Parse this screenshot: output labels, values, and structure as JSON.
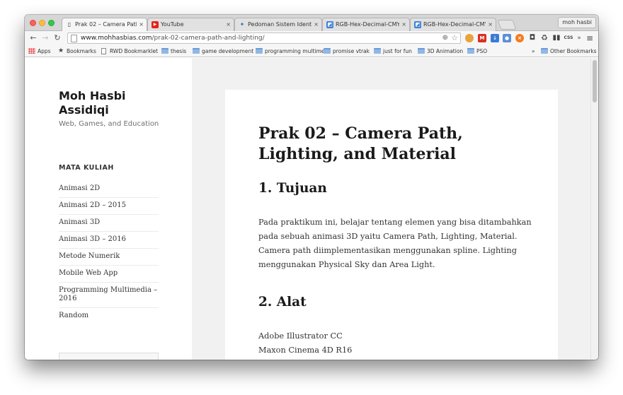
{
  "browser": {
    "tabs": [
      {
        "title": "Prak 02 – Camera Path, Lig",
        "icon": "page-icon",
        "active": true
      },
      {
        "title": "YouTube",
        "icon": "youtube-icon",
        "active": false
      },
      {
        "title": "Pedoman Sistem Identitas",
        "icon": "logo-icon",
        "active": false
      },
      {
        "title": "RGB-Hex-Decimal-CMYK C",
        "icon": "color-icon",
        "active": false
      },
      {
        "title": "RGB-Hex-Decimal-CMYK C",
        "icon": "color-icon",
        "active": false
      }
    ],
    "tab_close_glyph": "×",
    "profile_name": "moh hasbi",
    "url_domain": "www.mohhasbias.com",
    "url_path": "/prak-02-camera-path-and-lighting/",
    "extensions": [
      {
        "name": "cookie-icon",
        "color": "#e8a33a"
      },
      {
        "name": "gmail-icon",
        "color": "#d93025",
        "label": "M"
      },
      {
        "name": "download-icon",
        "color": "#3a7bd5"
      },
      {
        "name": "user-icon",
        "color": "#5b8fd8"
      },
      {
        "name": "block-icon",
        "color": "#f47b20"
      },
      {
        "name": "camera-icon",
        "color": "#444444"
      },
      {
        "name": "recycle-icon",
        "color": "#555555"
      },
      {
        "name": "columns-icon",
        "color": "#444444"
      },
      {
        "name": "css-icon",
        "color": "#444444",
        "label": "CSS"
      }
    ],
    "overflow_glyph": "»",
    "menu_glyph": "≡",
    "bookmarks": [
      {
        "label": "Apps",
        "icon": "apps-icon"
      },
      {
        "label": "Bookmarks",
        "icon": "star-icon"
      },
      {
        "label": "RWD Bookmarklet",
        "icon": "doc-icon"
      },
      {
        "label": "thesis",
        "icon": "folder-icon"
      },
      {
        "label": "game development",
        "icon": "folder-icon"
      },
      {
        "label": "programming multime",
        "icon": "folder-icon"
      },
      {
        "label": "promise vtrak",
        "icon": "folder-icon"
      },
      {
        "label": "just for fun",
        "icon": "folder-icon"
      },
      {
        "label": "3D Animation",
        "icon": "folder-icon"
      },
      {
        "label": "PSO",
        "icon": "folder-icon"
      }
    ],
    "bookmarks_overflow": "»",
    "other_bookmarks": "Other Bookmarks"
  },
  "sidebar": {
    "site_title": "Moh Hasbi Assidiqi",
    "site_description": "Web, Games, and Education",
    "widget_title": "MATA KULIAH",
    "menu_items": [
      "Animasi 2D",
      "Animasi 2D – 2015",
      "Animasi 3D",
      "Animasi 3D – 2016",
      "Metode Numerik",
      "Mobile Web App",
      "Programming Multimedia – 2016",
      "Random"
    ]
  },
  "article": {
    "title": "Prak 02 – Camera Path, Lighting, and Material",
    "section1_heading": "1. Tujuan",
    "section1_body": "Pada praktikum ini, belajar tentang elemen yang bisa ditambahkan pada sebuah animasi 3D yaitu Camera Path, Lighting, Material. Camera path diimplementasikan menggunakan spline. Lighting menggunakan Physical Sky dan Area Light.",
    "section2_heading": "2. Alat",
    "tools": [
      "Adobe Illustrator CC",
      "Maxon Cinema 4D R16"
    ]
  }
}
